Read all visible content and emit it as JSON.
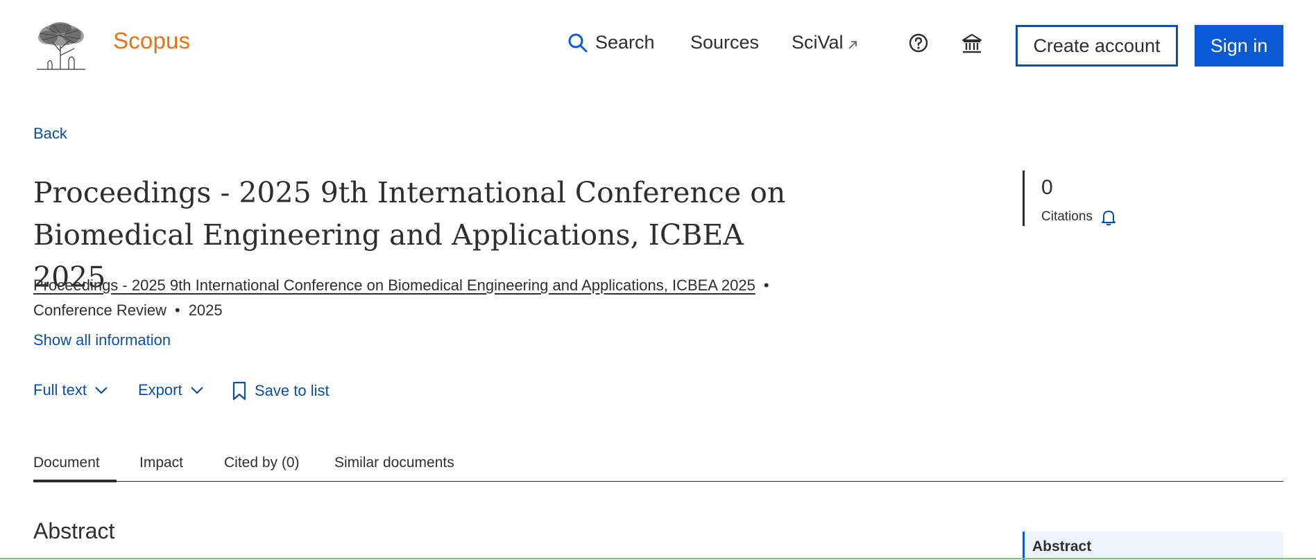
{
  "header": {
    "brand": "Scopus",
    "nav": {
      "search": "Search",
      "sources": "Sources",
      "scival": "SciVal"
    },
    "create_account": "Create account",
    "sign_in": "Sign in",
    "icons": [
      "search-icon",
      "external-link-icon",
      "help-icon",
      "institution-icon"
    ]
  },
  "page": {
    "back": "Back",
    "title": "Proceedings - 2025 9th International Conference on Biomedical Engineering and Applications, ICBEA 2025",
    "source_title": "Proceedings - 2025 9th International Conference on Biomedical Engineering and Applications, ICBEA 2025",
    "separator": "•",
    "doc_type": "Conference Review",
    "year": "2025",
    "show_all": "Show all information"
  },
  "actions": {
    "full_text": "Full text",
    "export": "Export",
    "save_to_list": "Save to list"
  },
  "citations": {
    "count": "0",
    "label": "Citations"
  },
  "tabs": [
    {
      "label": "Document",
      "active": true
    },
    {
      "label": "Impact"
    },
    {
      "label": "Cited by (0)"
    },
    {
      "label": "Similar documents"
    }
  ],
  "abstract": {
    "heading": "Abstract",
    "side_nav": "Abstract"
  },
  "colors": {
    "brand": "#e9711c",
    "link": "#0c4da2",
    "primary": "#0c59d4",
    "text": "#2e2e2e"
  }
}
